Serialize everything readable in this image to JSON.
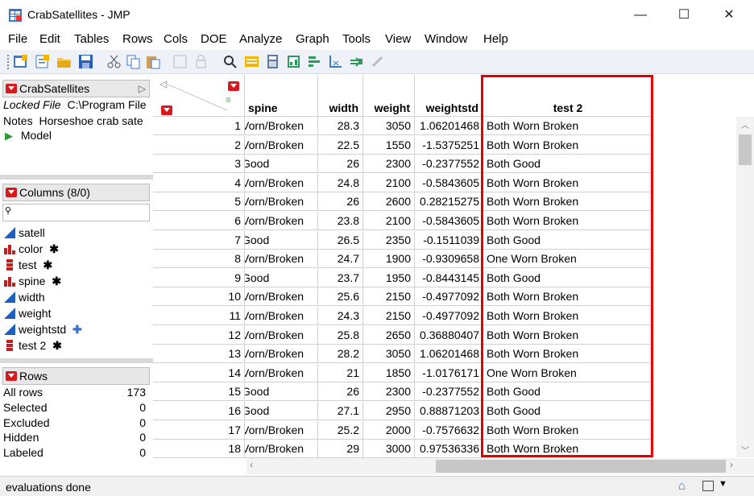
{
  "window": {
    "title": "CrabSatellites - JMP",
    "minimize": "—",
    "maximize": "☐",
    "close": "✕"
  },
  "menu": [
    "File",
    "Edit",
    "Tables",
    "Rows",
    "Cols",
    "DOE",
    "Analyze",
    "Graph",
    "Tools",
    "View",
    "Window",
    "Help"
  ],
  "table_panel": {
    "title": "CrabSatellites",
    "locked_label": "Locked File",
    "locked_path": "C:\\Program File",
    "notes_label": "Notes",
    "notes_value": "Horseshoe crab sate",
    "model": "Model"
  },
  "columns_panel": {
    "title": "Columns (8/0)",
    "search_placeholder": "",
    "items": [
      {
        "name": "satell",
        "type": "continuous",
        "flag": ""
      },
      {
        "name": "color",
        "type": "ordinal",
        "flag": "✱"
      },
      {
        "name": "test",
        "type": "nominal",
        "flag": "✱"
      },
      {
        "name": "spine",
        "type": "ordinal",
        "flag": "✱"
      },
      {
        "name": "width",
        "type": "continuous",
        "flag": ""
      },
      {
        "name": "weight",
        "type": "continuous",
        "flag": ""
      },
      {
        "name": "weightstd",
        "type": "continuous",
        "flag": "✚"
      },
      {
        "name": "test 2",
        "type": "nominal",
        "flag": "✱"
      }
    ]
  },
  "rows_panel": {
    "title": "Rows",
    "items": [
      {
        "label": "All rows",
        "value": "173"
      },
      {
        "label": "Selected",
        "value": "0"
      },
      {
        "label": "Excluded",
        "value": "0"
      },
      {
        "label": "Hidden",
        "value": "0"
      },
      {
        "label": "Labeled",
        "value": "0"
      }
    ]
  },
  "grid": {
    "headers": [
      "spine",
      "width",
      "weight",
      "weightstd",
      "test 2"
    ],
    "rows": [
      [
        "1",
        "Vorn/Broken",
        "28.3",
        "3050",
        "1.06201468",
        "Both Worn Broken"
      ],
      [
        "2",
        "Vorn/Broken",
        "22.5",
        "1550",
        "-1.5375251",
        "Both Worn Broken"
      ],
      [
        "3",
        "Good",
        "26",
        "2300",
        "-0.2377552",
        "Both Good"
      ],
      [
        "4",
        "Vorn/Broken",
        "24.8",
        "2100",
        "-0.5843605",
        "Both Worn Broken"
      ],
      [
        "5",
        "Vorn/Broken",
        "26",
        "2600",
        "0.28215275",
        "Both Worn Broken"
      ],
      [
        "6",
        "Vorn/Broken",
        "23.8",
        "2100",
        "-0.5843605",
        "Both Worn Broken"
      ],
      [
        "7",
        "Good",
        "26.5",
        "2350",
        "-0.1511039",
        "Both Good"
      ],
      [
        "8",
        "Vorn/Broken",
        "24.7",
        "1900",
        "-0.9309658",
        "One Worn Broken"
      ],
      [
        "9",
        "Good",
        "23.7",
        "1950",
        "-0.8443145",
        "Both Good"
      ],
      [
        "10",
        "Vorn/Broken",
        "25.6",
        "2150",
        "-0.4977092",
        "Both Worn Broken"
      ],
      [
        "11",
        "Vorn/Broken",
        "24.3",
        "2150",
        "-0.4977092",
        "Both Worn Broken"
      ],
      [
        "12",
        "Vorn/Broken",
        "25.8",
        "2650",
        "0.36880407",
        "Both Worn Broken"
      ],
      [
        "13",
        "Vorn/Broken",
        "28.2",
        "3050",
        "1.06201468",
        "Both Worn Broken"
      ],
      [
        "14",
        "Vorn/Broken",
        "21",
        "1850",
        "-1.0176171",
        "One Worn Broken"
      ],
      [
        "15",
        "Good",
        "26",
        "2300",
        "-0.2377552",
        "Both Good"
      ],
      [
        "16",
        "Good",
        "27.1",
        "2950",
        "0.88871203",
        "Both Good"
      ],
      [
        "17",
        "Vorn/Broken",
        "25.2",
        "2000",
        "-0.7576632",
        "Both Worn Broken"
      ],
      [
        "18",
        "Vorn/Broken",
        "29",
        "3000",
        "0.97536336",
        "Both Worn Broken"
      ]
    ]
  },
  "status": {
    "text": "evaluations done"
  },
  "colors": {
    "highlight": "#e00000",
    "accent_red": "#d9191e",
    "continuous_blue": "#1f5fbf"
  }
}
